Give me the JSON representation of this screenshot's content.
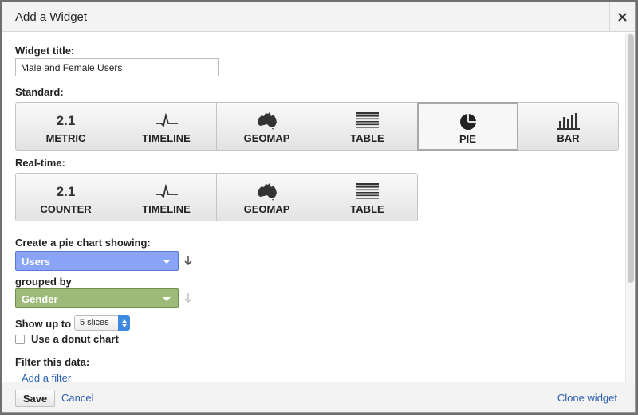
{
  "dialog": {
    "title": "Add a Widget"
  },
  "form": {
    "widget_title_label": "Widget title:",
    "widget_title_value": "Male and Female Users",
    "standard_label": "Standard:",
    "standard_options": [
      {
        "label": "METRIC",
        "icon": "metric-number-icon",
        "icon_text": "2.1"
      },
      {
        "label": "TIMELINE",
        "icon": "timeline-icon"
      },
      {
        "label": "GEOMAP",
        "icon": "australia-map-icon"
      },
      {
        "label": "TABLE",
        "icon": "table-icon"
      },
      {
        "label": "PIE",
        "icon": "pie-chart-icon",
        "selected": true
      },
      {
        "label": "BAR",
        "icon": "bar-chart-icon"
      }
    ],
    "realtime_label": "Real-time:",
    "realtime_options": [
      {
        "label": "COUNTER",
        "icon": "counter-number-icon",
        "icon_text": "2.1"
      },
      {
        "label": "TIMELINE",
        "icon": "timeline-icon"
      },
      {
        "label": "GEOMAP",
        "icon": "australia-map-icon"
      },
      {
        "label": "TABLE",
        "icon": "table-icon"
      }
    ],
    "pie_label": "Create a pie chart showing:",
    "metric_select": "Users",
    "grouped_by_label": "grouped by",
    "dimension_select": "Gender",
    "show_up_to_label": "Show up to",
    "slices_value": "5 slices",
    "donut_label": "Use a donut chart",
    "donut_checked": false,
    "filter_label": "Filter this data:",
    "add_filter_link": "Add a filter"
  },
  "footer": {
    "save_label": "Save",
    "cancel_label": "Cancel",
    "clone_label": "Clone widget"
  },
  "colors": {
    "metric_select": "#8aa4f8",
    "dimension_select": "#9dba78",
    "link": "#2a5db0"
  }
}
